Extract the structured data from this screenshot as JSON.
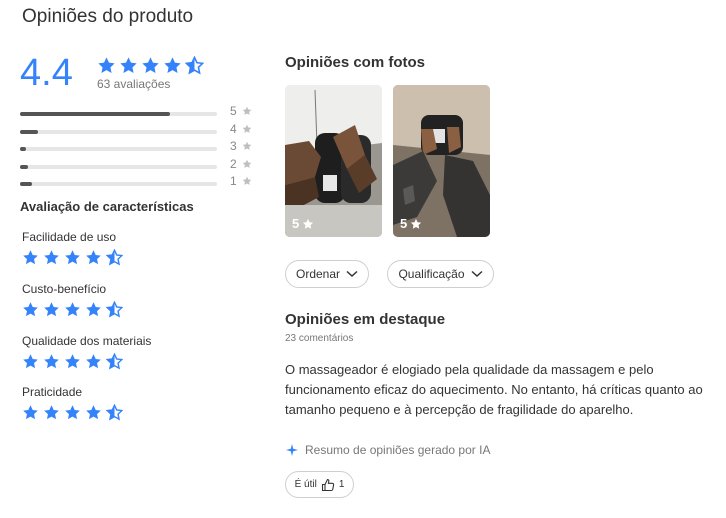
{
  "page": {
    "title": "Opiniões do produto"
  },
  "summary": {
    "average": "4.4",
    "count_label": "63 avaliações",
    "average_value": 4.4
  },
  "distribution": [
    {
      "stars": "5",
      "fraction": 0.76
    },
    {
      "stars": "4",
      "fraction": 0.09
    },
    {
      "stars": "3",
      "fraction": 0.03
    },
    {
      "stars": "2",
      "fraction": 0.04
    },
    {
      "stars": "1",
      "fraction": 0.06
    }
  ],
  "features": {
    "title": "Avaliação de características",
    "items": [
      {
        "label": "Facilidade de uso",
        "rating": 4.5
      },
      {
        "label": "Custo-benefício",
        "rating": 4.5
      },
      {
        "label": "Qualidade dos materiais",
        "rating": 4.5
      },
      {
        "label": "Praticidade",
        "rating": 4.5
      }
    ]
  },
  "photos": {
    "title": "Opiniões com fotos",
    "items": [
      {
        "rating": "5"
      },
      {
        "rating": "5"
      }
    ]
  },
  "filters": {
    "sort_label": "Ordenar",
    "rating_label": "Qualificação"
  },
  "highlights": {
    "title": "Opiniões em destaque",
    "comments": "23 comentários",
    "summary_text": "O massageador é elogiado pela qualidade da massagem e pelo funcionamento eficaz do aquecimento. No entanto, há críticas quanto ao tamanho pequeno e à percepção de fragilidade do aparelho.",
    "ai_note": "Resumo de opiniões gerado por IA",
    "useful_label": "É útil",
    "useful_count": "1"
  },
  "colors": {
    "accent": "#3483fa",
    "bar_fill": "#555555",
    "bar_track": "#e6e6e6",
    "star_grey": "#bfbfbf"
  }
}
